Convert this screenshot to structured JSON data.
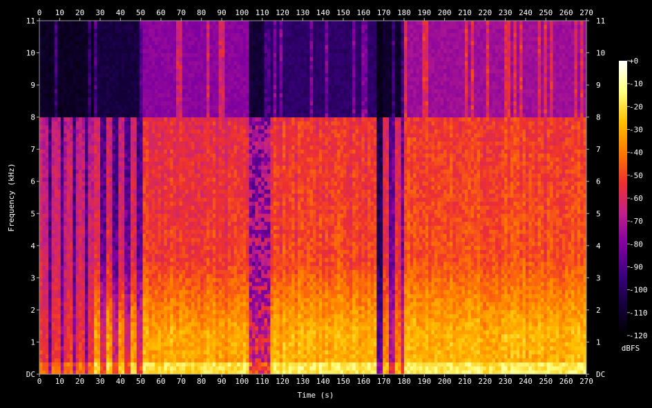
{
  "chart_data": {
    "type": "heatmap",
    "title": "",
    "xlabel": "Time (s)",
    "ylabel": "Frequency (kHz)",
    "colorbar_label": "dBFS",
    "x": {
      "min": 0,
      "max": 270,
      "ticks": [
        0,
        10,
        20,
        30,
        40,
        50,
        60,
        70,
        80,
        90,
        100,
        110,
        120,
        130,
        140,
        150,
        160,
        170,
        180,
        190,
        200,
        210,
        220,
        230,
        240,
        250,
        260,
        270
      ]
    },
    "y": {
      "min": 0,
      "max": 11,
      "ticks": [
        "DC",
        "1",
        "2",
        "3",
        "4",
        "5",
        "6",
        "7",
        "8",
        "9",
        "10",
        "11"
      ]
    },
    "colorbar": {
      "min": -120,
      "max": 0,
      "ticks": [
        "+0",
        "-10",
        "-20",
        "-30",
        "-40",
        "-50",
        "-60",
        "-70",
        "-80",
        "-90",
        "-100",
        "-110",
        "-120"
      ]
    },
    "colormap": [
      "#000000",
      "#14003c",
      "#3c0080",
      "#8000a0",
      "#c0208a",
      "#ee3030",
      "#ff7a00",
      "#ffc000",
      "#ffff80",
      "#ffffff"
    ],
    "segments": [
      {
        "start": 0,
        "end": 26,
        "low_db": -55,
        "mid_db": -62,
        "upper_db": -68,
        "cutoff_khz": 8,
        "above_db": -112,
        "pattern": "pulsed"
      },
      {
        "start": 26,
        "end": 51,
        "low_db": -35,
        "mid_db": -58,
        "upper_db": -64,
        "cutoff_khz": 8,
        "above_db": -106,
        "pattern": "pulsed"
      },
      {
        "start": 51,
        "end": 103,
        "low_db": -32,
        "mid_db": -52,
        "upper_db": -57,
        "cutoff_khz": 8,
        "above_db": -78,
        "pattern": "dense"
      },
      {
        "start": 103,
        "end": 113,
        "low_db": -55,
        "mid_db": -66,
        "upper_db": -70,
        "cutoff_khz": 8,
        "above_db": -108,
        "pattern": "sparse"
      },
      {
        "start": 113,
        "end": 166,
        "low_db": -30,
        "mid_db": -50,
        "upper_db": -54,
        "cutoff_khz": 8,
        "above_db": -98,
        "pattern": "dense"
      },
      {
        "start": 166,
        "end": 169,
        "low_db": -88,
        "mid_db": -100,
        "upper_db": -104,
        "cutoff_khz": 8,
        "above_db": -114,
        "pattern": "silent"
      },
      {
        "start": 169,
        "end": 179,
        "low_db": -40,
        "mid_db": -56,
        "upper_db": -60,
        "cutoff_khz": 8,
        "above_db": -110,
        "pattern": "pulsed"
      },
      {
        "start": 179,
        "end": 270,
        "low_db": -30,
        "mid_db": -48,
        "upper_db": -53,
        "cutoff_khz": 8,
        "above_db": -74,
        "pattern": "dense"
      }
    ]
  }
}
